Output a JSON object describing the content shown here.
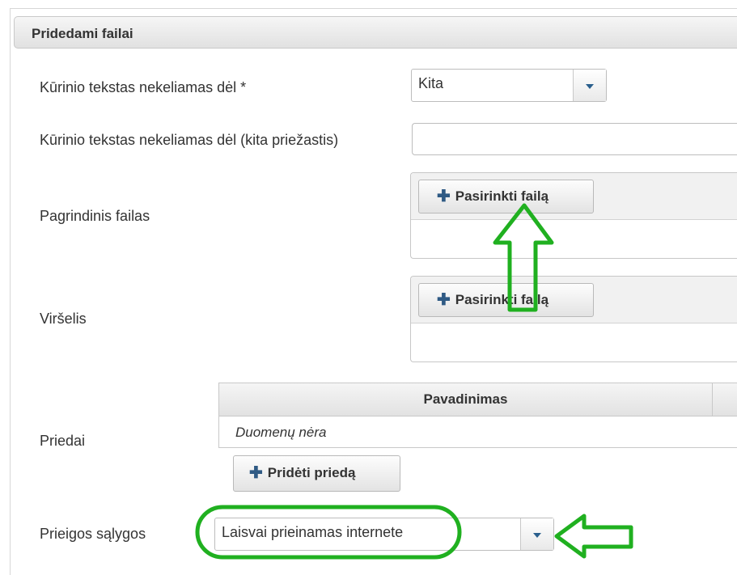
{
  "panel": {
    "title": "Pridedami failai"
  },
  "fields": {
    "reason": {
      "label": "Kūrinio tekstas nekeliamas dėl *",
      "value": "Kita"
    },
    "reason_other": {
      "label": "Kūrinio tekstas nekeliamas dėl (kita priežastis)",
      "value": ""
    },
    "main_file": {
      "label": "Pagrindinis failas",
      "button_label": "Pasirinkti failą"
    },
    "cover": {
      "label": "Viršelis",
      "button_label": "Pasirinkti failą"
    },
    "attachments": {
      "label": "Priedai",
      "column_header": "Pavadinimas",
      "empty_text": "Duomenų nėra",
      "add_button_label": "Pridėti priedą"
    },
    "access": {
      "label": "Prieigos sąlygos",
      "value": "Laisvai prieinamas internete"
    }
  },
  "icons": {
    "plus": "plus-icon",
    "dropdown": "chevron-down-icon"
  },
  "colors": {
    "annotation": "#20b020",
    "icon_blue": "#2f5a84"
  }
}
